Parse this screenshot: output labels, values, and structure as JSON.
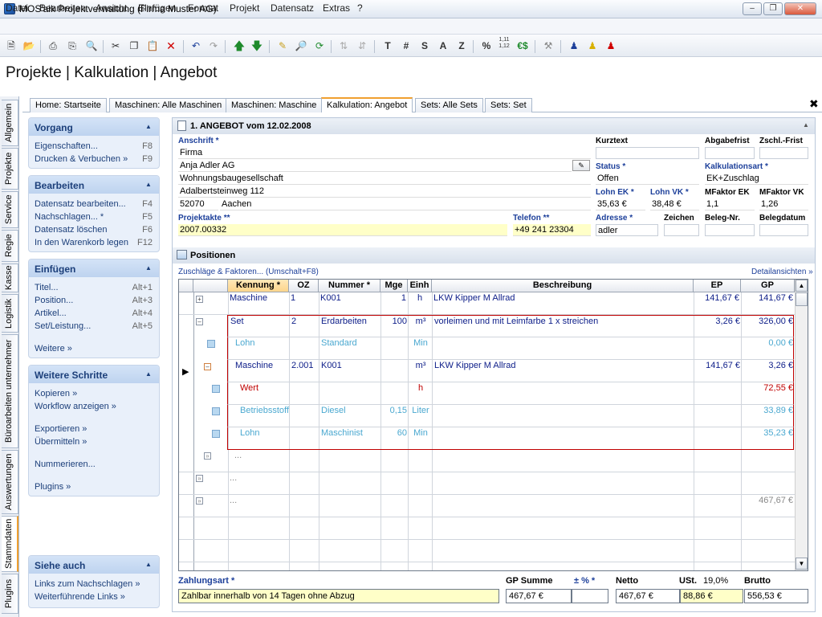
{
  "window": {
    "title": "MOS'aik Projektverwaltung (Firma Muster AG)"
  },
  "menu": [
    "Datei",
    "Bearbeiten",
    "Ansicht",
    "Einfügen",
    "Format",
    "Projekt",
    "Datensatz",
    "Extras",
    "?"
  ],
  "toolbar_text": {
    "t": "T",
    "hash": "#",
    "s": "S",
    "a": "A",
    "z": "Z",
    "percent": "%",
    "num": "1,11\n1,12",
    "euro": "€$"
  },
  "page_title": "Projekte | Kalkulation | Angebot",
  "tabs": [
    "Home: Startseite",
    "Maschinen: Alle Maschinen",
    "Maschinen: Maschine",
    "Kalkulation: Angebot",
    "Sets: Alle Sets",
    "Sets: Set"
  ],
  "vtabs": [
    "Allgemein",
    "Projekte",
    "Service",
    "Regie",
    "Kasse",
    "Logistik",
    "Büroarbeiten unternehmer",
    "Auswertungen",
    "Stammdaten",
    "Plugins"
  ],
  "sidebar": {
    "vorgang": {
      "title": "Vorgang",
      "items": [
        {
          "label": "Eigenschaften...",
          "key": "F8"
        },
        {
          "label": "Drucken & Verbuchen »",
          "key": "F9"
        }
      ]
    },
    "bearbeiten": {
      "title": "Bearbeiten",
      "items": [
        {
          "label": "Datensatz bearbeiten...",
          "key": "F4"
        },
        {
          "label": "Nachschlagen... *",
          "key": "F5"
        },
        {
          "label": "Datensatz löschen",
          "key": "F6"
        },
        {
          "label": "In den Warenkorb legen",
          "key": "F12"
        }
      ]
    },
    "einfuegen": {
      "title": "Einfügen",
      "items": [
        {
          "label": "Titel...",
          "key": "Alt+1"
        },
        {
          "label": "Position...",
          "key": "Alt+3"
        },
        {
          "label": "Artikel...",
          "key": "Alt+4"
        },
        {
          "label": "Set/Leistung...",
          "key": "Alt+5"
        }
      ],
      "weitere": "Weitere »"
    },
    "weitere_schritte": {
      "title": "Weitere Schritte",
      "items": [
        "Kopieren »",
        "Workflow anzeigen »",
        "Exportieren »",
        "Übermitteln »",
        "Nummerieren...",
        "Plugins »"
      ]
    },
    "siehe_auch": {
      "title": "Siehe auch",
      "items": [
        "Links zum Nachschlagen »",
        "Weiterführende Links »"
      ]
    }
  },
  "angebot": {
    "header": "1. ANGEBOT vom 12.02.2008",
    "anschrift_label": "Anschrift *",
    "anschrift": [
      "Firma",
      "Anja Adler AG",
      "Wohnungsbaugesellschaft",
      "Adalbertsteinweg 112"
    ],
    "plz": "52070",
    "ort": "Aachen",
    "projektakte_label": "Projektakte **",
    "projektakte": "2007.00332",
    "telefon_label": "Telefon **",
    "telefon": "+49 241 23304",
    "kurztext_label": "Kurztext",
    "abgabefrist_label": "Abgabefrist",
    "zschl_label": "Zschl.-Frist",
    "status_label": "Status *",
    "status": "Offen",
    "kalkart_label": "Kalkulationsart *",
    "kalkart": "EK+Zuschlag",
    "lohn_ek_label": "Lohn EK *",
    "lohn_ek": "35,63 €",
    "lohn_vk_label": "Lohn VK *",
    "lohn_vk": "38,48 €",
    "mfaktor_ek_label": "MFaktor EK",
    "mfaktor_ek": "1,1",
    "mfaktor_vk_label": "MFaktor VK",
    "mfaktor_vk": "1,26",
    "adresse_label": "Adresse *",
    "adresse": "adler",
    "zeichen_label": "Zeichen",
    "belegnr_label": "Beleg-Nr.",
    "belegdatum_label": "Belegdatum"
  },
  "positionen": {
    "header": "Positionen",
    "zuschlaege_link": "Zuschläge & Faktoren... (Umschalt+F8)",
    "detail_link": "Detailansichten »",
    "columns": [
      "Kennung *",
      "OZ",
      "Nummer *",
      "Mge",
      "Einh",
      "Beschreibung",
      "EP",
      "GP"
    ],
    "rows": [
      {
        "kennung": "Maschine",
        "oz": "1",
        "nummer": "K001",
        "mge": "1",
        "einh": "h",
        "beschreibung": "LKW Kipper M Allrad",
        "ep": "141,67 €",
        "gp": "141,67 €"
      },
      {
        "kennung": "Set",
        "oz": "2",
        "nummer": "Erdarbeiten",
        "mge": "100",
        "einh": "m³",
        "beschreibung": "vorleimen und mit Leimfarbe 1 x streichen",
        "ep": "3,26 €",
        "gp": "326,00 €"
      },
      {
        "kennung": "Lohn",
        "oz": "",
        "nummer": "Standard",
        "mge": "",
        "einh": "Min",
        "beschreibung": "",
        "ep": "",
        "gp": "0,00 €"
      },
      {
        "kennung": "Maschine",
        "oz": "2.001",
        "nummer": "K001",
        "mge": "",
        "einh": "m³",
        "beschreibung": "LKW Kipper M Allrad",
        "ep": "141,67 €",
        "gp": "3,26 €"
      },
      {
        "kennung": "Wert",
        "oz": "",
        "nummer": "",
        "mge": "",
        "einh": "h",
        "beschreibung": "",
        "ep": "",
        "gp": "72,55 €"
      },
      {
        "kennung": "Betriebsstoff",
        "oz": "",
        "nummer": "Diesel",
        "mge": "0,15",
        "einh": "Liter",
        "beschreibung": "",
        "ep": "",
        "gp": "33,89 €"
      },
      {
        "kennung": "Lohn",
        "oz": "",
        "nummer": "Maschinist",
        "mge": "60",
        "einh": "Min",
        "beschreibung": "",
        "ep": "",
        "gp": "35,23 €"
      },
      {
        "kennung": "...",
        "oz": "",
        "nummer": "",
        "mge": "",
        "einh": "",
        "beschreibung": "",
        "ep": "",
        "gp": ""
      },
      {
        "kennung": "...",
        "oz": "",
        "nummer": "",
        "mge": "",
        "einh": "",
        "beschreibung": "",
        "ep": "",
        "gp": ""
      },
      {
        "kennung": "...",
        "oz": "",
        "nummer": "",
        "mge": "",
        "einh": "",
        "beschreibung": "",
        "ep": "",
        "gp": "467,67 €"
      }
    ]
  },
  "totals": {
    "zahlungsart_label": "Zahlungsart *",
    "zahlungsart": "Zahlbar innerhalb von 14 Tagen ohne Abzug",
    "gp_summe_label": "GP Summe",
    "gp_summe": "467,67 €",
    "pm_label": "± % *",
    "pm": "",
    "netto_label": "Netto",
    "netto": "467,67 €",
    "ust_label": "USt.",
    "ust_rate": "19,0%",
    "ust": "88,86 €",
    "brutto_label": "Brutto",
    "brutto": "556,53 €"
  }
}
